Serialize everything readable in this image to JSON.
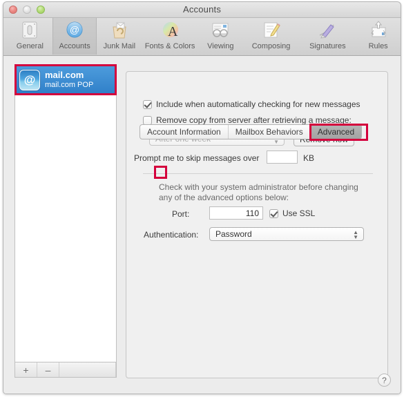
{
  "window": {
    "title": "Accounts",
    "traffic_lights": [
      "close-button",
      "minimize-button",
      "zoom-button"
    ]
  },
  "toolbar": {
    "items": [
      {
        "label": "General",
        "icon": "general-icon",
        "selected": false
      },
      {
        "label": "Accounts",
        "icon": "accounts-icon",
        "selected": true
      },
      {
        "label": "Junk Mail",
        "icon": "junk-mail-icon",
        "selected": false
      },
      {
        "label": "Fonts & Colors",
        "icon": "fonts-colors-icon",
        "selected": false
      },
      {
        "label": "Viewing",
        "icon": "viewing-icon",
        "selected": false
      },
      {
        "label": "Composing",
        "icon": "composing-icon",
        "selected": false
      },
      {
        "label": "Signatures",
        "icon": "signatures-icon",
        "selected": false
      },
      {
        "label": "Rules",
        "icon": "rules-icon",
        "selected": false
      }
    ]
  },
  "sidebar": {
    "accounts": [
      {
        "name": "mail.com",
        "type": "mail.com POP",
        "icon": "at-sign-icon",
        "selected": true
      }
    ],
    "add_label": "+",
    "remove_label": "–"
  },
  "tabs": [
    {
      "label": "Account Information",
      "active": false
    },
    {
      "label": "Mailbox Behaviors",
      "active": false
    },
    {
      "label": "Advanced",
      "active": true
    }
  ],
  "advanced": {
    "include_checkbox": {
      "label": "Include when automatically checking for new messages",
      "checked": true
    },
    "remove_copy_checkbox": {
      "label": "Remove copy from server after retrieving a message:",
      "checked": false
    },
    "remove_interval": {
      "value": "After one week",
      "enabled": false
    },
    "remove_now_button": "Remove now",
    "prompt_skip": {
      "label_before": "Prompt me to skip messages over",
      "value": "",
      "unit": "KB"
    },
    "admin_note": "Check with your system administrator before changing any of the advanced options below:",
    "port": {
      "label": "Port:",
      "value": "110"
    },
    "use_ssl": {
      "label": "Use SSL",
      "checked": true
    },
    "authentication": {
      "label": "Authentication:",
      "value": "Password"
    }
  },
  "help_button": "?",
  "highlights": {
    "color": "#d4003c",
    "targets": [
      "account-row",
      "advanced-tab",
      "remove-copy-checkbox"
    ]
  }
}
